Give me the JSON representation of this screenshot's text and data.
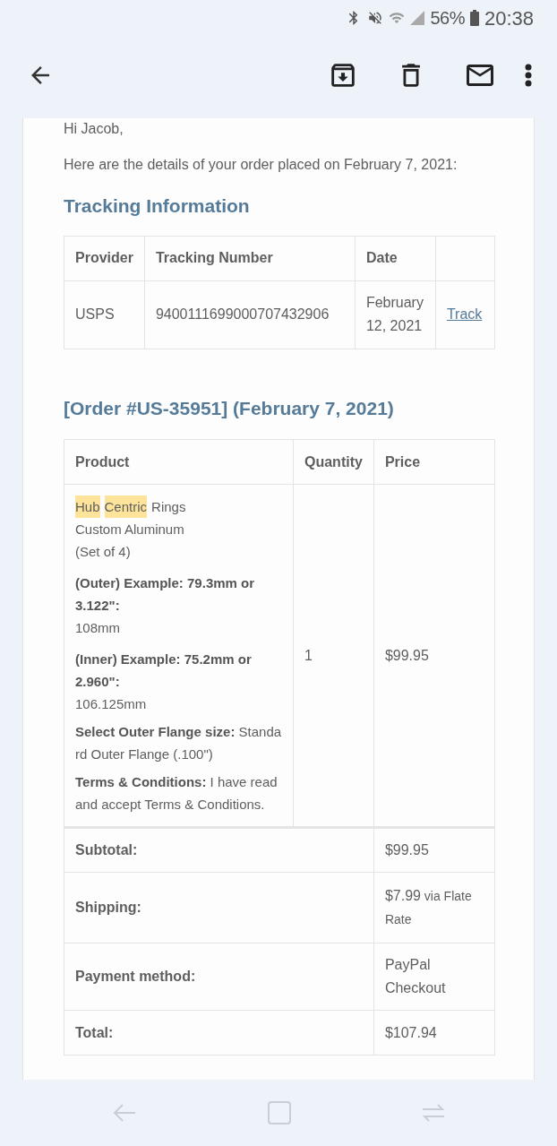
{
  "status_bar": {
    "battery": "56%",
    "time": "20:38"
  },
  "email": {
    "greeting": "Hi Jacob,",
    "intro": "Here are the details of your order placed on February 7, 2021:",
    "tracking": {
      "title": "Tracking Information",
      "columns": [
        "Provider",
        "Tracking Number",
        "Date"
      ],
      "rows": [
        {
          "provider": "USPS",
          "tracking_number": "9400111699000707432906",
          "date": "February 12, 2021",
          "link": "Track"
        }
      ]
    },
    "order": {
      "title": "[Order #US-35951] (February 7, 2021)",
      "columns": [
        "Product",
        "Quantity",
        "Price"
      ],
      "items": [
        {
          "name_parts": [
            {
              "text": "Hub",
              "highlighted": true
            },
            {
              "text": "Centric",
              "highlighted": true
            },
            {
              "text": "Rings",
              "highlighted": false
            }
          ],
          "name_lines": [
            "Custom Aluminum",
            "(Set of 4)"
          ],
          "meta": [
            {
              "label": "(Outer) Example: 79.3mm or 3.122\":",
              "value": "108mm",
              "inline": false
            },
            {
              "label": "(Inner) Example: 75.2mm or 2.960\":",
              "value": "106.125mm",
              "inline": false
            },
            {
              "label": "Select Outer Flange size:",
              "value": "Standard Outer Flange (.100\")",
              "inline": true
            },
            {
              "label": "Terms & Conditions:",
              "value": "I have read and accept Terms & Conditions.",
              "inline": true
            }
          ],
          "quantity": "1",
          "price": "$99.95"
        }
      ],
      "totals": [
        {
          "label": "Subtotal:",
          "value": "$99.95"
        },
        {
          "label": "Shipping:",
          "value": "$7.99",
          "note": "via Flate Rate"
        },
        {
          "label": "Payment method:",
          "value": "PayPal Checkout"
        },
        {
          "label": "Total:",
          "value": "$107.94"
        }
      ]
    }
  }
}
